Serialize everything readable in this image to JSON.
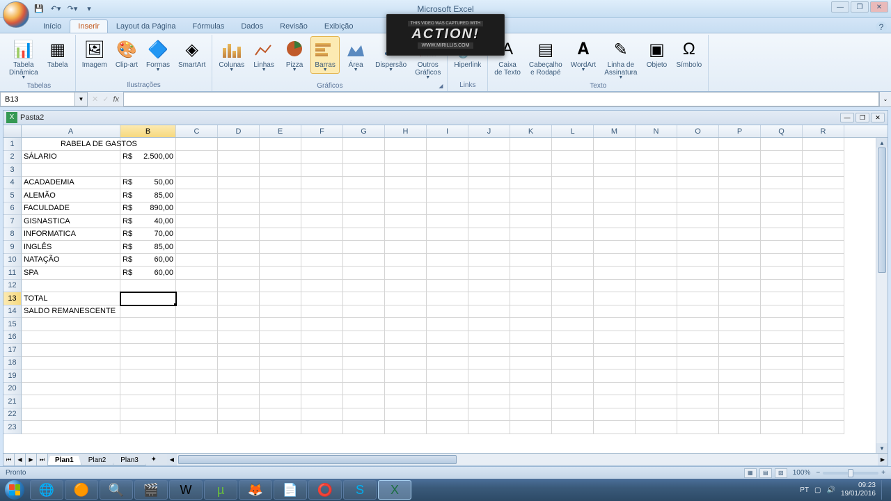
{
  "app_title": "Microsoft Excel",
  "workbook_name": "Pasta2",
  "name_box": "B13",
  "formula_value": "",
  "tabs": [
    "Início",
    "Inserir",
    "Layout da Página",
    "Fórmulas",
    "Dados",
    "Revisão",
    "Exibição"
  ],
  "active_tab_index": 1,
  "ribbon": {
    "groups": [
      {
        "label": "Tabelas",
        "buttons": [
          {
            "label": "Tabela\nDinâmica",
            "dropdown": true
          },
          {
            "label": "Tabela"
          }
        ]
      },
      {
        "label": "Ilustrações",
        "buttons": [
          {
            "label": "Imagem"
          },
          {
            "label": "Clip-art"
          },
          {
            "label": "Formas",
            "dropdown": true
          },
          {
            "label": "SmartArt"
          }
        ]
      },
      {
        "label": "Gráficos",
        "launcher": true,
        "buttons": [
          {
            "label": "Colunas",
            "dropdown": true
          },
          {
            "label": "Linhas",
            "dropdown": true
          },
          {
            "label": "Pizza",
            "dropdown": true
          },
          {
            "label": "Barras",
            "dropdown": true,
            "active": true
          },
          {
            "label": "Área",
            "dropdown": true
          },
          {
            "label": "Dispersão",
            "dropdown": true
          },
          {
            "label": "Outros\nGráficos",
            "dropdown": true
          }
        ]
      },
      {
        "label": "Links",
        "buttons": [
          {
            "label": "Hiperlink"
          }
        ]
      },
      {
        "label": "Texto",
        "buttons": [
          {
            "label": "Caixa\nde Texto"
          },
          {
            "label": "Cabeçalho\ne Rodapé"
          },
          {
            "label": "WordArt",
            "dropdown": true
          },
          {
            "label": "Linha de\nAssinatura",
            "dropdown": true
          },
          {
            "label": "Objeto"
          },
          {
            "label": "Símbolo"
          }
        ]
      }
    ]
  },
  "watermark": {
    "top": "THIS VIDEO WAS CAPTURED WITH",
    "main": "ACTION!",
    "bottom": "WWW.MIRILLIS.COM"
  },
  "columns": [
    "A",
    "B",
    "C",
    "D",
    "E",
    "F",
    "G",
    "H",
    "I",
    "J",
    "K",
    "L",
    "M",
    "N",
    "O",
    "P",
    "Q",
    "R"
  ],
  "selected_col": "B",
  "selected_row": 13,
  "cells": {
    "title": "RABELA DE GASTOS",
    "rows": [
      {
        "r": 2,
        "a": "SÁLARIO",
        "prefix": "R$",
        "num": "2.500,00"
      },
      {
        "r": 3,
        "a": "",
        "prefix": "",
        "num": ""
      },
      {
        "r": 4,
        "a": "ACADADEMIA",
        "prefix": "R$",
        "num": "50,00"
      },
      {
        "r": 5,
        "a": "ALEMÃO",
        "prefix": "R$",
        "num": "85,00"
      },
      {
        "r": 6,
        "a": "FACULDADE",
        "prefix": "R$",
        "num": "890,00"
      },
      {
        "r": 7,
        "a": "GISNASTICA",
        "prefix": "R$",
        "num": "40,00"
      },
      {
        "r": 8,
        "a": "INFORMATICA",
        "prefix": "R$",
        "num": "70,00"
      },
      {
        "r": 9,
        "a": "INGLÊS",
        "prefix": "R$",
        "num": "85,00"
      },
      {
        "r": 10,
        "a": "NATAÇÃO",
        "prefix": "R$",
        "num": "60,00"
      },
      {
        "r": 11,
        "a": "SPA",
        "prefix": "R$",
        "num": "60,00"
      },
      {
        "r": 12,
        "a": "",
        "prefix": "",
        "num": ""
      },
      {
        "r": 13,
        "a": "TOTAL",
        "prefix": "",
        "num": ""
      },
      {
        "r": 14,
        "a": "SALDO REMANESCENTE",
        "prefix": "",
        "num": ""
      }
    ]
  },
  "sheets": [
    "Plan1",
    "Plan2",
    "Plan3"
  ],
  "active_sheet": 0,
  "status": "Pronto",
  "zoom": "100%",
  "tray": {
    "lang": "PT",
    "time": "09:23",
    "date": "19/01/2016"
  }
}
